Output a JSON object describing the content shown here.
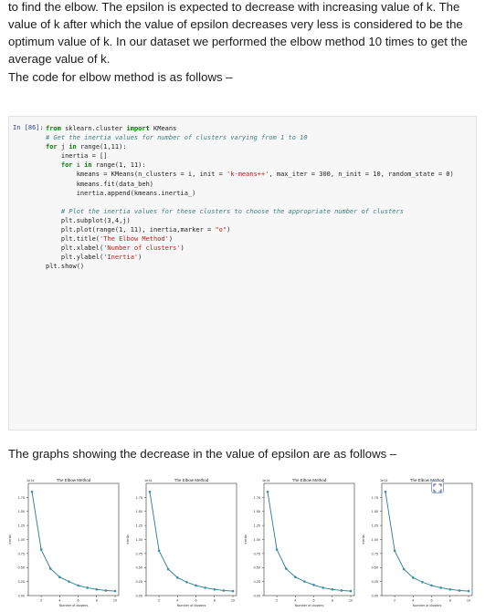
{
  "paragraphs": {
    "p1": "to find the elbow. The epsilon is expected to decrease with increasing value of k. The value of k after which the value of epsilon decreases very less is considered to be the optimum value of k. In our dataset we performed the elbow method 10 times to get the average value of k.",
    "p2": "The code for elbow method is as follows –",
    "p3": "The graphs showing the decrease in the value of epsilon are as follows –"
  },
  "code": {
    "prompt": "In [86]:",
    "lines": [
      "from sklearn.cluster import KMeans",
      "# Get the inertia values for number of clusters varying from 1 to 10",
      "for j in range(1,11):",
      "    inertia = []",
      "    for i in range(1, 11):",
      "        kmeans = KMeans(n_clusters = i, init = 'k-means++', max_iter = 300, n_init = 10, random_state = 0)",
      "        kmeans.fit(data_beh)",
      "        inertia.append(kmeans.inertia_)",
      "",
      "    # Plot the inertia values for these clusters to choose the appropriate number of clusters",
      "    plt.subplot(3,4,j)",
      "    plt.plot(range(1, 11), inertia,marker = \"o\")",
      "    plt.title('The Elbow Method')",
      "    plt.xlabel('Number of clusters')",
      "    plt.ylabel('Inertia')",
      "plt.show()"
    ]
  },
  "chart_data": [
    {
      "type": "line",
      "title": "The Elbow Method",
      "xlabel": "Number of clusters",
      "ylabel": "Inertia",
      "scale_label": "1e14",
      "x": [
        1,
        2,
        3,
        4,
        5,
        6,
        7,
        8,
        9,
        10
      ],
      "series": [
        {
          "values": [
            1.85,
            0.82,
            0.48,
            0.33,
            0.25,
            0.18,
            0.14,
            0.11,
            0.09,
            0.08
          ]
        }
      ],
      "ylim": [
        0.0,
        2.0
      ],
      "yticks": [
        "0.00",
        "0.25",
        "0.50",
        "0.75",
        "1.00",
        "1.25",
        "1.50",
        "1.75"
      ],
      "xticks": [
        "2",
        "4",
        "6",
        "8",
        "10"
      ]
    },
    {
      "type": "line",
      "title": "The Elbow Method",
      "xlabel": "Number of clusters",
      "ylabel": "Inertia",
      "scale_label": "1e14",
      "x": [
        1,
        2,
        3,
        4,
        5,
        6,
        7,
        8,
        9,
        10
      ],
      "series": [
        {
          "values": [
            1.85,
            0.8,
            0.47,
            0.32,
            0.24,
            0.18,
            0.14,
            0.11,
            0.09,
            0.08
          ]
        }
      ],
      "ylim": [
        0.0,
        2.0
      ],
      "yticks": [
        "0.00",
        "0.25",
        "0.50",
        "0.75",
        "1.00",
        "1.25",
        "1.50",
        "1.75"
      ],
      "xticks": [
        "2",
        "4",
        "6",
        "8",
        "10"
      ]
    },
    {
      "type": "line",
      "title": "The Elbow Method",
      "xlabel": "Number of clusters",
      "ylabel": "Inertia",
      "scale_label": "1e14",
      "x": [
        1,
        2,
        3,
        4,
        5,
        6,
        7,
        8,
        9,
        10
      ],
      "series": [
        {
          "values": [
            1.85,
            0.82,
            0.48,
            0.33,
            0.25,
            0.19,
            0.14,
            0.11,
            0.09,
            0.08
          ]
        }
      ],
      "ylim": [
        0.0,
        2.0
      ],
      "yticks": [
        "0.00",
        "0.25",
        "0.50",
        "0.75",
        "1.00",
        "1.25",
        "1.50",
        "1.75"
      ],
      "xticks": [
        "2",
        "4",
        "6",
        "8",
        "10"
      ]
    },
    {
      "type": "line",
      "title": "The Elbow Method",
      "xlabel": "Number of clusters",
      "ylabel": "Inertia",
      "scale_label": "1e14",
      "x": [
        1,
        2,
        3,
        4,
        5,
        6,
        7,
        8,
        9,
        10
      ],
      "series": [
        {
          "values": [
            1.85,
            0.8,
            0.47,
            0.32,
            0.24,
            0.18,
            0.14,
            0.11,
            0.09,
            0.08
          ]
        }
      ],
      "ylim": [
        0.0,
        2.0
      ],
      "yticks": [
        "0.00",
        "0.25",
        "0.50",
        "0.75",
        "1.00",
        "1.25",
        "1.50",
        "1.75"
      ],
      "xticks": [
        "2",
        "4",
        "6",
        "8",
        "10"
      ]
    }
  ],
  "colors": {
    "line": "#2a7a8c",
    "marker": "#3b8fa6",
    "comment": "#408080",
    "keyword": "#008000",
    "string": "#ba2121",
    "number": "#666666"
  },
  "icons": {
    "expand": "expand-icon"
  }
}
